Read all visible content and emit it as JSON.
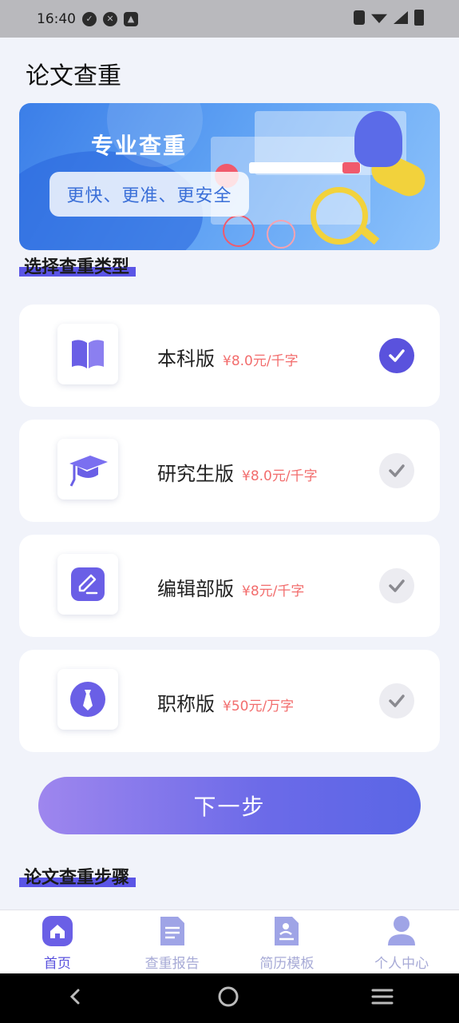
{
  "status_bar": {
    "time": "16:40"
  },
  "page": {
    "title": "论文查重"
  },
  "banner": {
    "heading": "专业查重",
    "tagline": "更快、更准、更安全"
  },
  "section_type": {
    "title": "选择查重类型"
  },
  "options": [
    {
      "name": "本科版",
      "price": "¥8.0元/千字",
      "selected": true,
      "icon": "book-icon"
    },
    {
      "name": "研究生版",
      "price": "¥8.0元/千字",
      "selected": false,
      "icon": "graduation-cap-icon"
    },
    {
      "name": "编辑部版",
      "price": "¥8元/千字",
      "selected": false,
      "icon": "edit-icon"
    },
    {
      "name": "职称版",
      "price": "¥50元/万字",
      "selected": false,
      "icon": "tie-icon"
    }
  ],
  "next_button": {
    "label": "下一步"
  },
  "section_steps": {
    "title": "论文查重步骤"
  },
  "tabs": [
    {
      "label": "首页",
      "active": true,
      "icon": "home-icon"
    },
    {
      "label": "查重报告",
      "active": false,
      "icon": "report-icon"
    },
    {
      "label": "简历模板",
      "active": false,
      "icon": "resume-icon"
    },
    {
      "label": "个人中心",
      "active": false,
      "icon": "user-icon"
    }
  ],
  "colors": {
    "accent": "#5a52dd",
    "price": "#f26d6d",
    "tab_inactive": "#a7aad6"
  }
}
